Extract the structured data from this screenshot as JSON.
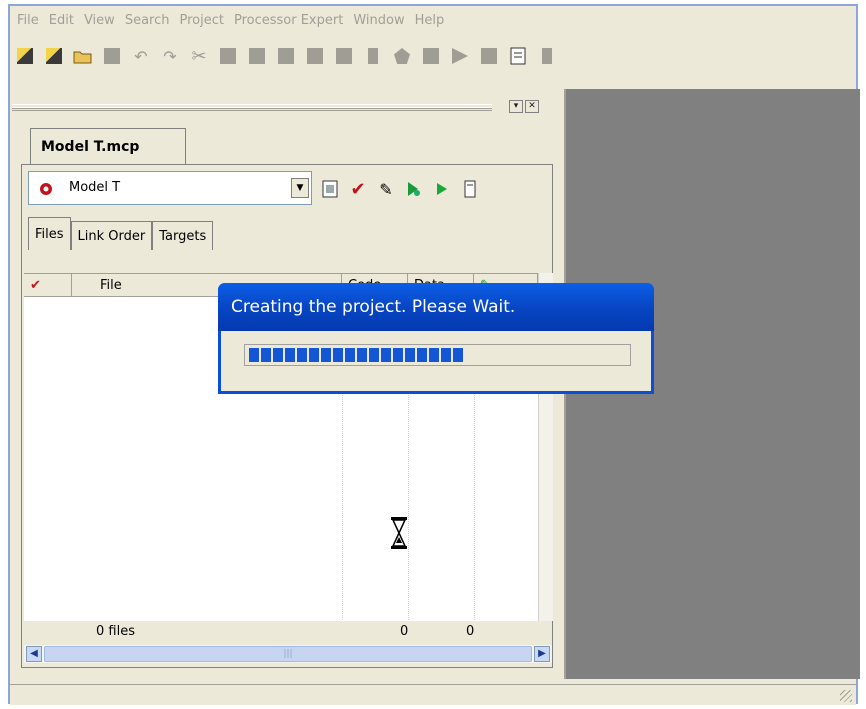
{
  "menubar": {
    "items": [
      "File",
      "Edit",
      "View",
      "Search",
      "Project",
      "Processor Expert",
      "Window",
      "Help"
    ]
  },
  "toolbar": {
    "icons": [
      "new-project-icon",
      "new-file-icon",
      "open-folder-icon",
      "save-icon",
      "undo-icon",
      "redo-icon",
      "cut-icon",
      "copy-icon",
      "paste-icon",
      "find-icon",
      "find-next-icon",
      "replace-icon",
      "compile-icon",
      "make-icon",
      "debug-icon",
      "run-icon",
      "stop-icon",
      "properties-icon",
      "window-icon"
    ]
  },
  "project": {
    "doc_tab": "Model T.mcp",
    "target": "Model T",
    "subtabs": [
      "Files",
      "Link Order",
      "Targets"
    ],
    "columns": [
      "File",
      "Code",
      "Data"
    ],
    "footer": {
      "files": "0 files",
      "code": "0",
      "data": "0"
    }
  },
  "dialog": {
    "title": "Creating the project. Please Wait.",
    "progress": 0.55
  },
  "colors": {
    "accent": "#0a4fd8",
    "progress": "#1457d6",
    "editor_bg": "#808080"
  }
}
